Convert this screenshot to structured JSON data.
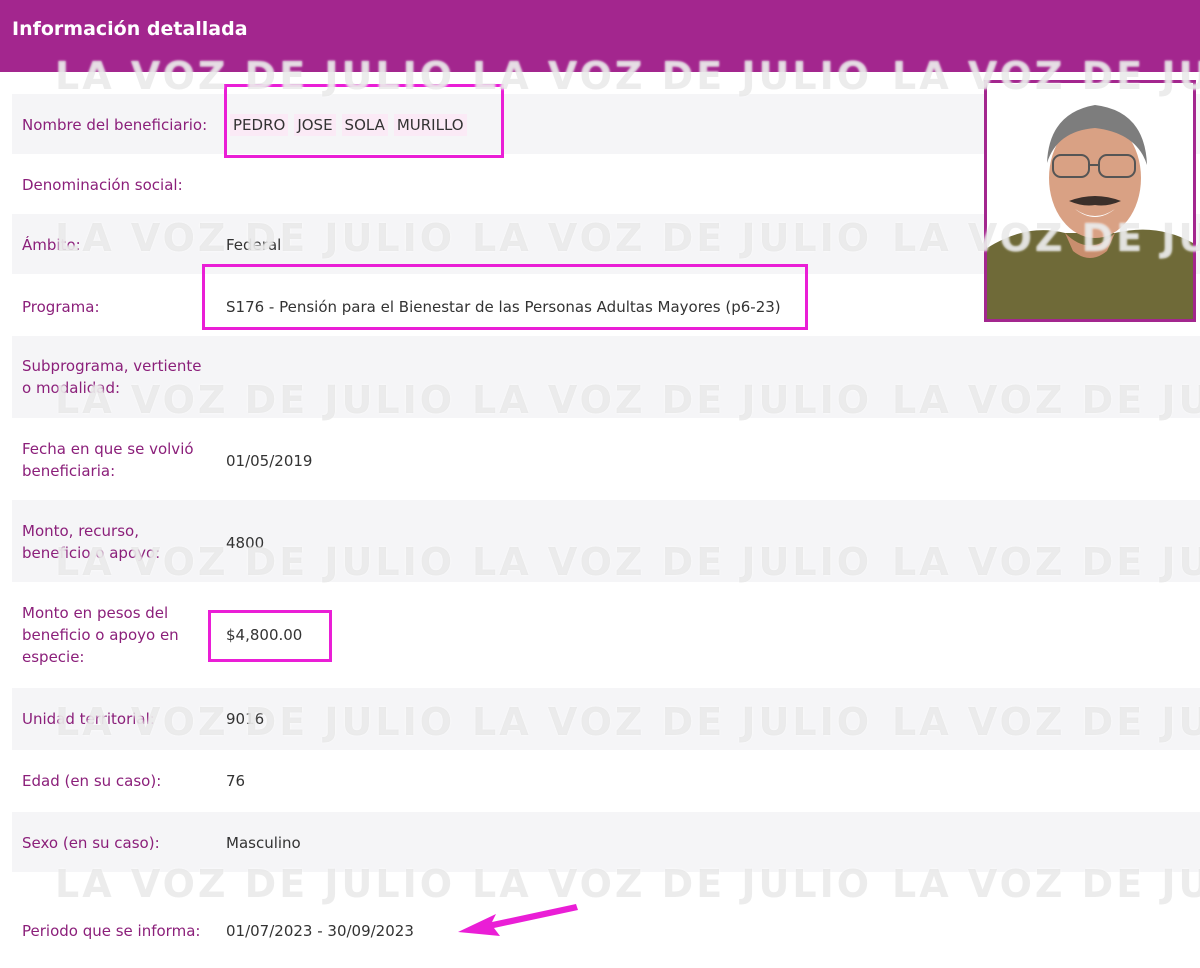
{
  "header": {
    "title": "Información detallada"
  },
  "fields": {
    "nombre": {
      "label": "Nombre del beneficiario:",
      "parts": [
        "PEDRO",
        "JOSE",
        "SOLA",
        "MURILLO"
      ]
    },
    "denominacion": {
      "label": "Denominación social:",
      "value": ""
    },
    "ambito": {
      "label": "Ámbito:",
      "value": "Federal"
    },
    "programa": {
      "label": "Programa:",
      "value": "S176 - Pensión para el Bienestar de las Personas Adultas Mayores (p6-23)"
    },
    "subprograma": {
      "label_line1": "Subprograma, vertiente",
      "label_line2": "o modalidad:",
      "value": ""
    },
    "fecha": {
      "label_line1": "Fecha en que se volvió",
      "label_line2": "beneficiaria:",
      "value": "01/05/2019"
    },
    "monto": {
      "label_line1": "Monto, recurso,",
      "label_line2": "beneficio o apoyo:",
      "value": "4800"
    },
    "monto_pesos": {
      "label_line1": "Monto en pesos del",
      "label_line2": "beneficio o apoyo en",
      "label_line3": "especie:",
      "value": "$4,800.00"
    },
    "unidad": {
      "label": "Unidad territorial:",
      "value": "9016"
    },
    "edad": {
      "label": "Edad (en su caso):",
      "value": "76"
    },
    "sexo": {
      "label": "Sexo (en su caso):",
      "value": "Masculino"
    },
    "periodo": {
      "label": "Periodo que se informa:",
      "value": "01/07/2023 - 30/09/2023"
    }
  },
  "watermark": {
    "text": "LA VOZ DE JULIO"
  },
  "colors": {
    "header": "#a3268e",
    "label": "#8b1f7a",
    "highlight": "#ea1ed6",
    "row_shade": "#f5f5f7"
  }
}
